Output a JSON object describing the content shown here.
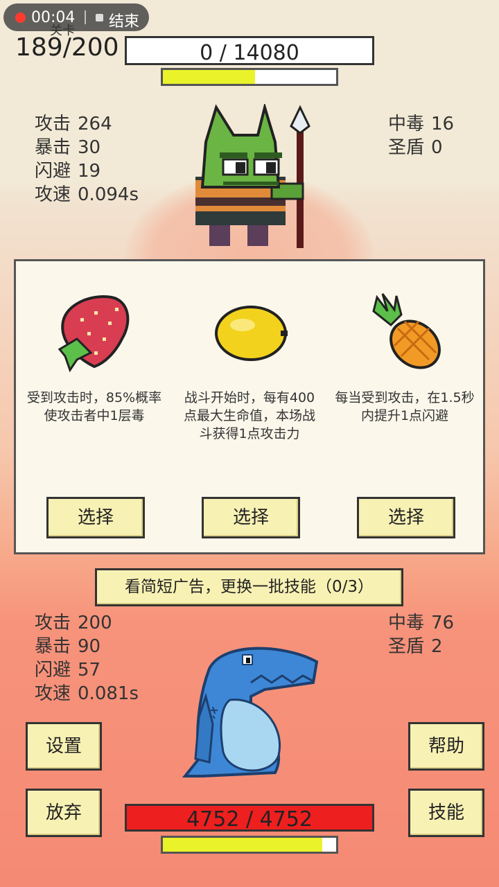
{
  "recorder": {
    "time": "00:04",
    "end_label": "结束"
  },
  "level": {
    "caption": "关卡",
    "value": "189/200"
  },
  "enemy": {
    "hp_text": "0 / 14080",
    "energy_fraction": 0.53,
    "stats_left": [
      {
        "label": "攻击",
        "value": "264"
      },
      {
        "label": "暴击",
        "value": "30"
      },
      {
        "label": "闪避",
        "value": "19"
      },
      {
        "label": "攻速",
        "value": "0.094s"
      }
    ],
    "stats_right": [
      {
        "label": "中毒",
        "value": "16"
      },
      {
        "label": "圣盾",
        "value": "0"
      }
    ]
  },
  "skills": [
    {
      "icon": "strawberry-icon",
      "desc": "受到攻击时，85%概率使攻击者中1层毒",
      "button": "选择"
    },
    {
      "icon": "lemon-icon",
      "desc": "战斗开始时，每有400点最大生命值，本场战斗获得1点攻击力",
      "button": "选择"
    },
    {
      "icon": "pineapple-icon",
      "desc": "每当受到攻击，在1.5秒内提升1点闪避",
      "button": "选择"
    }
  ],
  "ad_button": "看简短广告，更换一批技能（0/3）",
  "player": {
    "hp_text": "4752 / 4752",
    "energy_fraction": 0.92,
    "stats_left": [
      {
        "label": "攻击",
        "value": "200"
      },
      {
        "label": "暴击",
        "value": "90"
      },
      {
        "label": "闪避",
        "value": "57"
      },
      {
        "label": "攻速",
        "value": "0.081s"
      }
    ],
    "stats_right": [
      {
        "label": "中毒",
        "value": "76"
      },
      {
        "label": "圣盾",
        "value": "2"
      }
    ]
  },
  "buttons": {
    "settings": "设置",
    "giveup": "放弃",
    "help": "帮助",
    "skills": "技能"
  },
  "colors": {
    "hp_red": "#ee1f1f",
    "energy_yellow": "#eaf22a",
    "button_bg": "#f8f1b4"
  }
}
